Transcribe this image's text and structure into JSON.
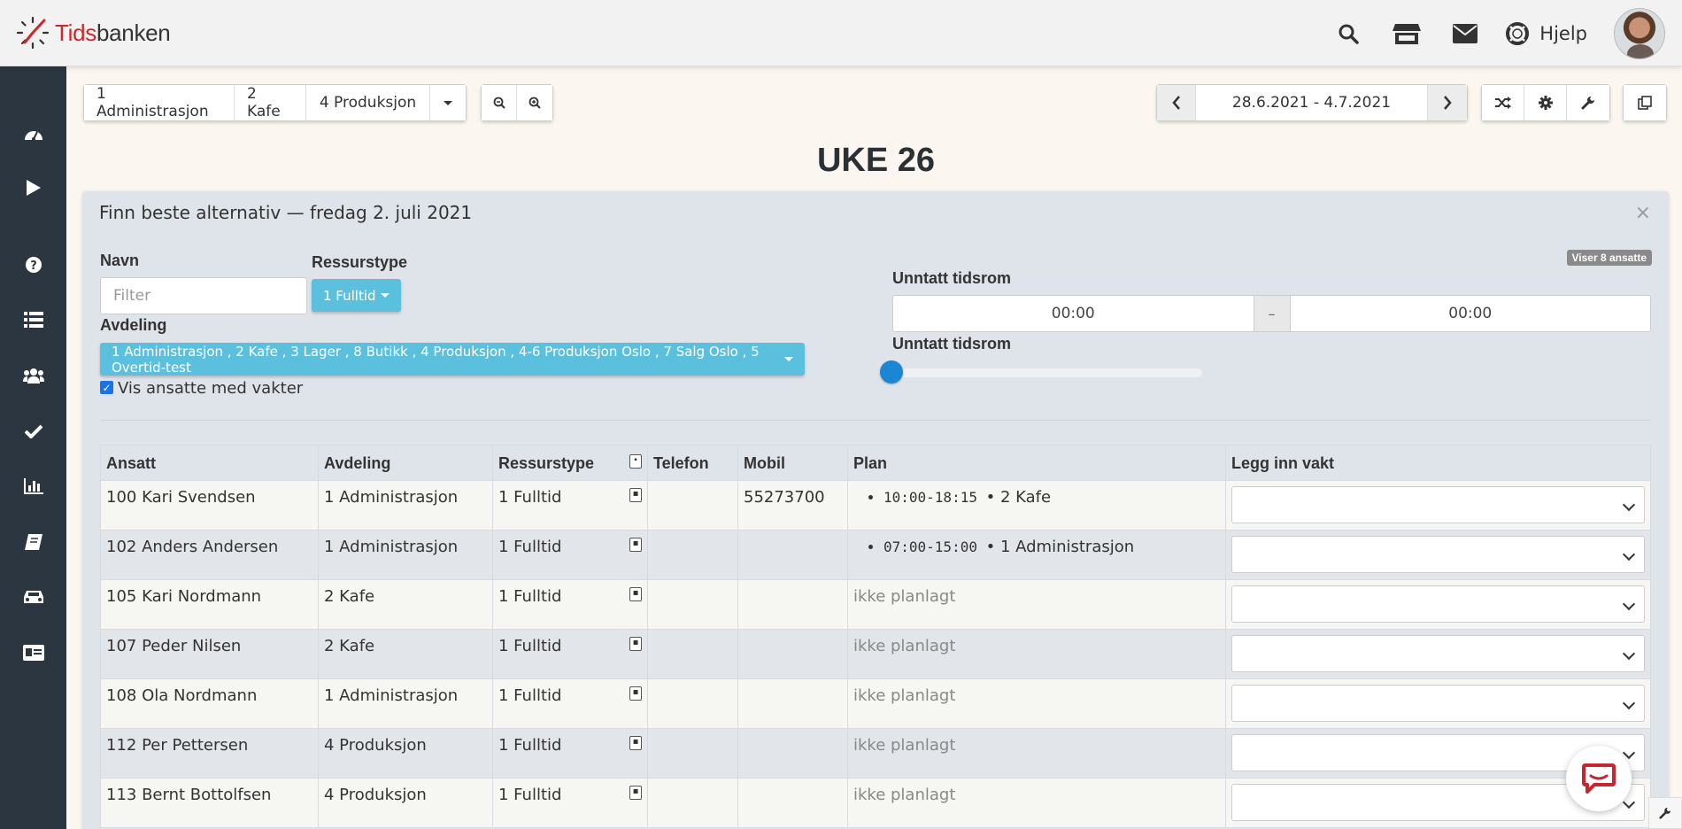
{
  "brand": {
    "name_red": "Tids",
    "name_rest": "banken"
  },
  "header": {
    "help_label": "Hjelp",
    "icons": [
      "search-icon",
      "store-icon",
      "envelope-icon",
      "lifebuoy-icon"
    ]
  },
  "sidebar": {
    "items": [
      "dashboard-icon",
      "play-icon",
      "question-icon",
      "list-icon",
      "users-icon",
      "check-icon",
      "bar-chart-icon",
      "book-icon",
      "car-icon",
      "id-card-icon"
    ]
  },
  "toolbar": {
    "departments": [
      "1 Administrasjon",
      "2 Kafe",
      "4 Produksjon"
    ],
    "date_range": "28.6.2021 - 4.7.2021"
  },
  "week_title": "UKE 26",
  "panel": {
    "title": "Finn beste alternativ — fredag 2. juli 2021",
    "close": "×",
    "name_label": "Navn",
    "filter_placeholder": "Filter",
    "resource_label": "Ressurstype",
    "resource_value": "1 Fulltid",
    "department_label": "Avdeling",
    "department_value": "1 Administrasjon , 2 Kafe , 3 Lager , 8 Butikk , 4 Produksjon , 4-6 Produksjon Oslo , 7 Salg Oslo , 5 Overtid-test",
    "show_with_shifts_label": "Vis ansatte med vakter",
    "show_with_shifts_checked": true,
    "count_badge": "Viser 8 ansatte",
    "except_period_label": "Unntatt tidsrom",
    "time_from": "00:00",
    "time_sep": "–",
    "time_to": "00:00",
    "except_period_label_2": "Unntatt tidsrom"
  },
  "table": {
    "headers": {
      "employee": "Ansatt",
      "department": "Avdeling",
      "resource": "Ressurstype",
      "phone": "Telefon",
      "mobile": "Mobil",
      "plan": "Plan",
      "add_shift": "Legg inn vakt"
    },
    "rows": [
      {
        "employee": "100 Kari Svendsen",
        "department": "1 Administrasjon",
        "resource": "1 Fulltid",
        "phone": "",
        "mobile": "55273700",
        "plan_time": "10:00-18:15",
        "plan_dept": "• 2 Kafe",
        "planned": true
      },
      {
        "employee": "102 Anders Andersen",
        "department": "1 Administrasjon",
        "resource": "1 Fulltid",
        "phone": "",
        "mobile": "",
        "plan_time": "07:00-15:00",
        "plan_dept": "• 1 Administrasjon",
        "planned": true
      },
      {
        "employee": "105 Kari Nordmann",
        "department": "2 Kafe",
        "resource": "1 Fulltid",
        "phone": "",
        "mobile": "",
        "plan_text": "ikke planlagt",
        "planned": false
      },
      {
        "employee": "107 Peder Nilsen",
        "department": "2 Kafe",
        "resource": "1 Fulltid",
        "phone": "",
        "mobile": "",
        "plan_text": "ikke planlagt",
        "planned": false
      },
      {
        "employee": "108 Ola Nordmann",
        "department": "1 Administrasjon",
        "resource": "1 Fulltid",
        "phone": "",
        "mobile": "",
        "plan_text": "ikke planlagt",
        "planned": false
      },
      {
        "employee": "112 Per Pettersen",
        "department": "4 Produksjon",
        "resource": "1 Fulltid",
        "phone": "",
        "mobile": "",
        "plan_text": "ikke planlagt",
        "planned": false
      },
      {
        "employee": "113 Bernt Bottolfsen",
        "department": "4 Produksjon",
        "resource": "1 Fulltid",
        "phone": "",
        "mobile": "",
        "plan_text": "ikke planlagt",
        "planned": false
      }
    ]
  },
  "colors": {
    "sidebar": "#2c3640",
    "accent_blue": "#5bc0de",
    "brand_red": "#d0262a",
    "slider": "#1b87d4",
    "chat": "#c4272d"
  }
}
